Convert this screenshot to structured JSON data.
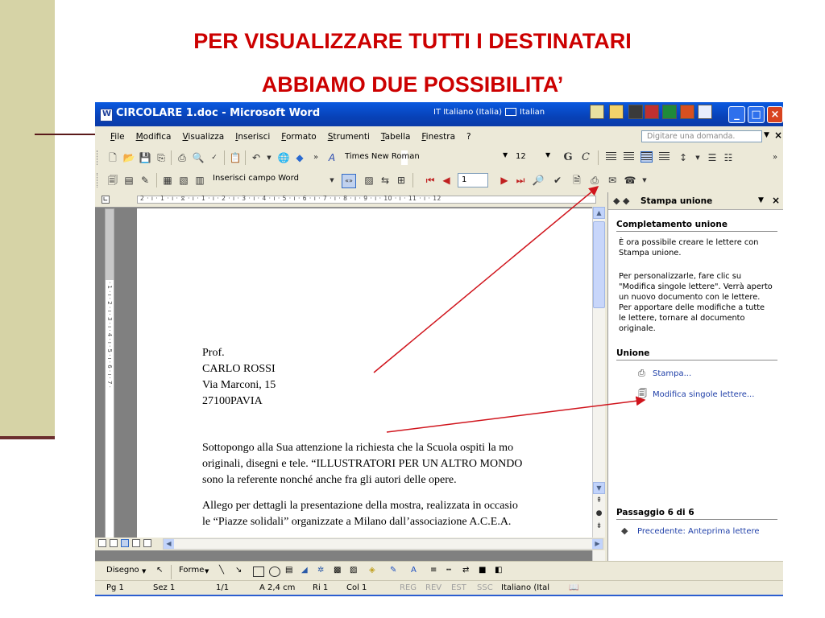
{
  "slide": {
    "title_line1": "PER VISUALIZZARE TUTTI I DESTINATARI",
    "title_line2": "ABBIAMO DUE POSSIBILITA’"
  },
  "window": {
    "title": "CIRCOLARE 1.doc - Microsoft Word",
    "language_indicator": "IT Italiano (Italia)",
    "language_short": "Italian"
  },
  "menu": {
    "items": [
      "File",
      "Modifica",
      "Visualizza",
      "Inserisci",
      "Formato",
      "Strumenti",
      "Tabella",
      "Finestra",
      "?"
    ],
    "ask_placeholder": "Digitare una domanda."
  },
  "formatting": {
    "font": "Times New Roman",
    "size": "12",
    "bold_label": "G",
    "italic_label": "C"
  },
  "mailmerge_toolbar": {
    "insert_field_label": "Inserisci campo Word",
    "record": "1"
  },
  "ruler": {
    "horizontal": "2 · ı · 1 · ı · ⧖ · ı · 1 · ı · 2 · ı · 3 · ı · 4 · ı · 5 · ı · 6 · ı · 7 · ı · 8 · ı · 9 · ı · 10 · ı · 11 · ı · 12",
    "vertical": "· 1 · ı · 2 · ı · 3 · ı · 4 · ı · 5 · ı · 6 · ı · 7 ·"
  },
  "document": {
    "address": [
      "Prof.",
      "CARLO ROSSI",
      "Via Marconi, 15",
      "27100PAVIA"
    ],
    "para1": [
      "Sottopongo alla Sua attenzione la richiesta che la Scuola ospiti la mo",
      "originali, disegni e tele. “ILLUSTRATORI PER UN ALTRO MONDO",
      "sono la referente nonché anche fra gli autori  delle opere."
    ],
    "para2": [
      "Allego per dettagli la presentazione della mostra, realizzata in occasio",
      "le “Piazze solidali” organizzate a Milano dall’associazione A.C.E.A."
    ]
  },
  "taskpane": {
    "title": "Stampa unione",
    "section1": "Completamento unione",
    "text1": "È ora possibile creare le lettere con Stampa unione.",
    "text2": "Per personalizzarle, fare clic su \"Modifica singole lettere\". Verrà aperto un nuovo documento con le lettere. Per apportare delle modifiche a tutte le lettere, tornare al documento originale.",
    "section2": "Unione",
    "link_print": "Stampa...",
    "link_edit": "Modifica singole lettere...",
    "step": "Passaggio 6 di 6",
    "link_prev": "Precedente: Anteprima lettere"
  },
  "drawing": {
    "draw_label": "Disegno",
    "shapes_label": "Forme"
  },
  "status": {
    "page": "Pg 1",
    "section": "Sez 1",
    "pages": "1/1",
    "at": "A 2,4 cm",
    "line": "Ri 1",
    "col": "Col 1",
    "rec": "REG",
    "rev": "REV",
    "ext": "EST",
    "ovr": "SSC",
    "language": "Italiano (Ital"
  },
  "colors": {
    "title_red": "#cc0000",
    "side_band": "#d6d3a6",
    "arrow_red": "#d0141c",
    "xp_blue": "#0a5ae0",
    "link_blue": "#1f3fa8"
  }
}
